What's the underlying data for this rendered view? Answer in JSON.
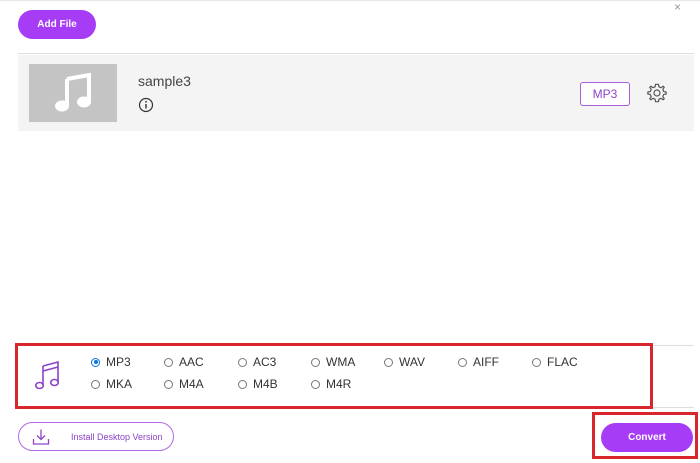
{
  "toolbar": {
    "add_file_label": "Add File",
    "corner_mark": "×"
  },
  "file": {
    "name": "sample3",
    "output_format": "MP3"
  },
  "formats": {
    "selected": "MP3",
    "row1": [
      "MP3",
      "AAC",
      "AC3",
      "WMA",
      "WAV",
      "AIFF",
      "FLAC"
    ],
    "row2": [
      "MKA",
      "M4A",
      "M4B",
      "M4R"
    ]
  },
  "footer": {
    "install_label": "Install Desktop Version",
    "convert_label": "Convert"
  },
  "colors": {
    "accent": "#a73cf6",
    "highlight_box": "#d9262c",
    "radio_selected": "#0a74dc"
  }
}
